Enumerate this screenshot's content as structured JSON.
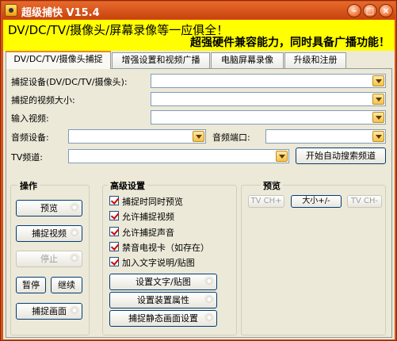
{
  "window": {
    "title": "超级捕快  V15.4"
  },
  "banner": {
    "line1": "DV/DC/TV/摄像头/屏幕录像等一应俱全！",
    "line2": "超强硬件兼容能力，同时具备广播功能！"
  },
  "tabs": [
    {
      "label": "DV/DC/TV/摄像头捕捉",
      "active": true
    },
    {
      "label": "增强设置和视频广播",
      "active": false
    },
    {
      "label": "电脑屏幕录像",
      "active": false
    },
    {
      "label": "升级和注册",
      "active": false
    }
  ],
  "form": {
    "capture_device_label": "捕捉设备(DV/DC/TV/摄像头):",
    "capture_device_value": "",
    "video_size_label": "捕捉的视频大小:",
    "video_size_value": "",
    "video_input_label": "输入视频:",
    "video_input_value": "",
    "audio_device_label": "音频设备:",
    "audio_device_value": "",
    "audio_port_label": "音频端口:",
    "audio_port_value": "",
    "tv_channel_label": "TV频道:",
    "tv_channel_value": "",
    "auto_search_button": "开始自动搜索频道"
  },
  "operations": {
    "title": "操作",
    "preview": "预览",
    "capture_video": "捕捉视频",
    "stop": "停止",
    "pause": "暂停",
    "resume": "继续",
    "capture_image": "捕捉画面"
  },
  "advanced": {
    "title": "高级设置",
    "checkboxes": [
      {
        "label": "捕捉时同时预览",
        "checked": true
      },
      {
        "label": "允许捕捉视频",
        "checked": true
      },
      {
        "label": "允许捕捉声音",
        "checked": true
      },
      {
        "label": "禁音电视卡（如存在）",
        "checked": true
      },
      {
        "label": "加入文字说明/贴图",
        "checked": true
      }
    ],
    "set_text_button": "设置文字/贴图",
    "device_props_button": "设置装置属性",
    "still_image_button": "捕捉静态画面设置"
  },
  "preview_group": {
    "title": "预览",
    "tv_ch_plus": "TV CH+",
    "size_button": "大小+/-",
    "tv_ch_minus": "TV CH-"
  },
  "colors": {
    "titlebar": "#d6531a",
    "banner": "#ffff00",
    "checkmark": "#cc0000"
  },
  "icons": {
    "app": "camera-app-icon",
    "minimize": "minimize-icon",
    "maximize": "maximize-icon",
    "close": "close-icon"
  }
}
